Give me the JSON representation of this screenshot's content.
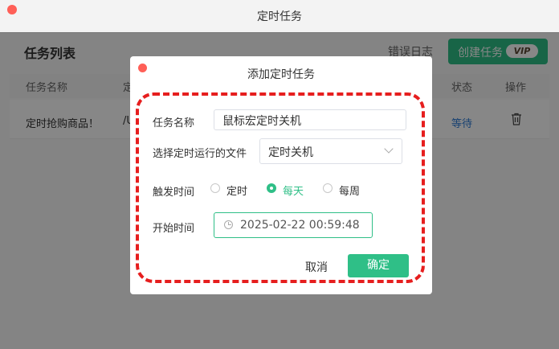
{
  "window": {
    "title": "定时任务"
  },
  "toolbar": {
    "list_title": "任务列表",
    "error_log": "错误日志",
    "create_label": "创建任务",
    "vip_badge": "VIP"
  },
  "table": {
    "headers": {
      "name": "任务名称",
      "col2": "定",
      "status": "状态",
      "action": "操作"
    },
    "rows": [
      {
        "name": "定时抢购商品！",
        "col2": "/U",
        "status": "等待"
      }
    ]
  },
  "dialog": {
    "title": "添加定时任务",
    "task_name_label": "任务名称",
    "task_name_value": "鼠标宏定时关机",
    "file_label": "选择定时运行的文件",
    "file_value": "定时关机",
    "trigger_label": "触发时间",
    "trigger_options": [
      "定时",
      "每天",
      "每周"
    ],
    "trigger_selected": "每天",
    "start_label": "开始时间",
    "start_value": "2025-02-22 00:59:48",
    "cancel_label": "取消",
    "ok_label": "确定",
    "highlight_color": "#e61e1e",
    "accent_color": "#2fbf87"
  }
}
